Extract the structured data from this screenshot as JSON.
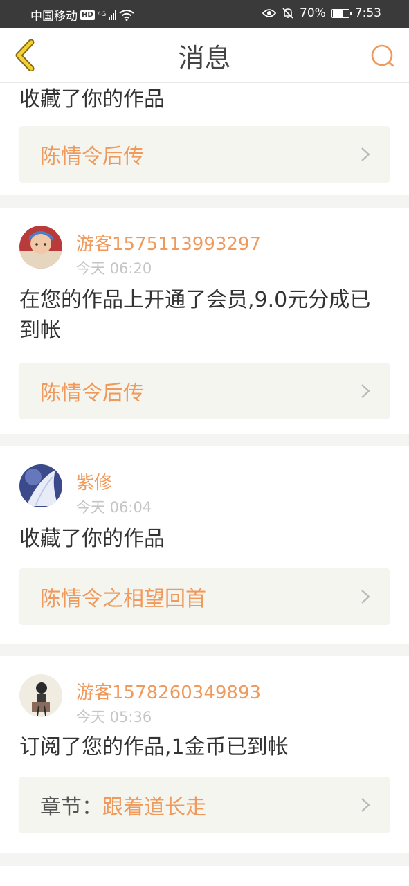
{
  "status_bar": {
    "carrier": "中国移动",
    "hd": "HD",
    "network": "4G",
    "battery": "70%",
    "battery_level": 0.7,
    "time": "7:53"
  },
  "header": {
    "title": "消息"
  },
  "colors": {
    "accent": "#ef9a5c",
    "link_bg": "#f5f5ef",
    "separator": "#f4f4f2"
  },
  "messages": [
    {
      "text": "收藏了你的作品",
      "work_title": "陈情令后传"
    },
    {
      "user": "游客1575113993297",
      "time": "今天 06:20",
      "text": "在您的作品上开通了会员,9.0元分成已到帐",
      "work_title": "陈情令后传"
    },
    {
      "user": "紫修",
      "time": "今天 06:04",
      "text": "收藏了你的作品",
      "work_title": "陈情令之相望回首"
    },
    {
      "user": "游客1578260349893",
      "time": "今天 05:36",
      "text": "订阅了您的作品,1金币已到帐",
      "work_prefix": "章节：",
      "work_title": "跟着道长走"
    }
  ]
}
